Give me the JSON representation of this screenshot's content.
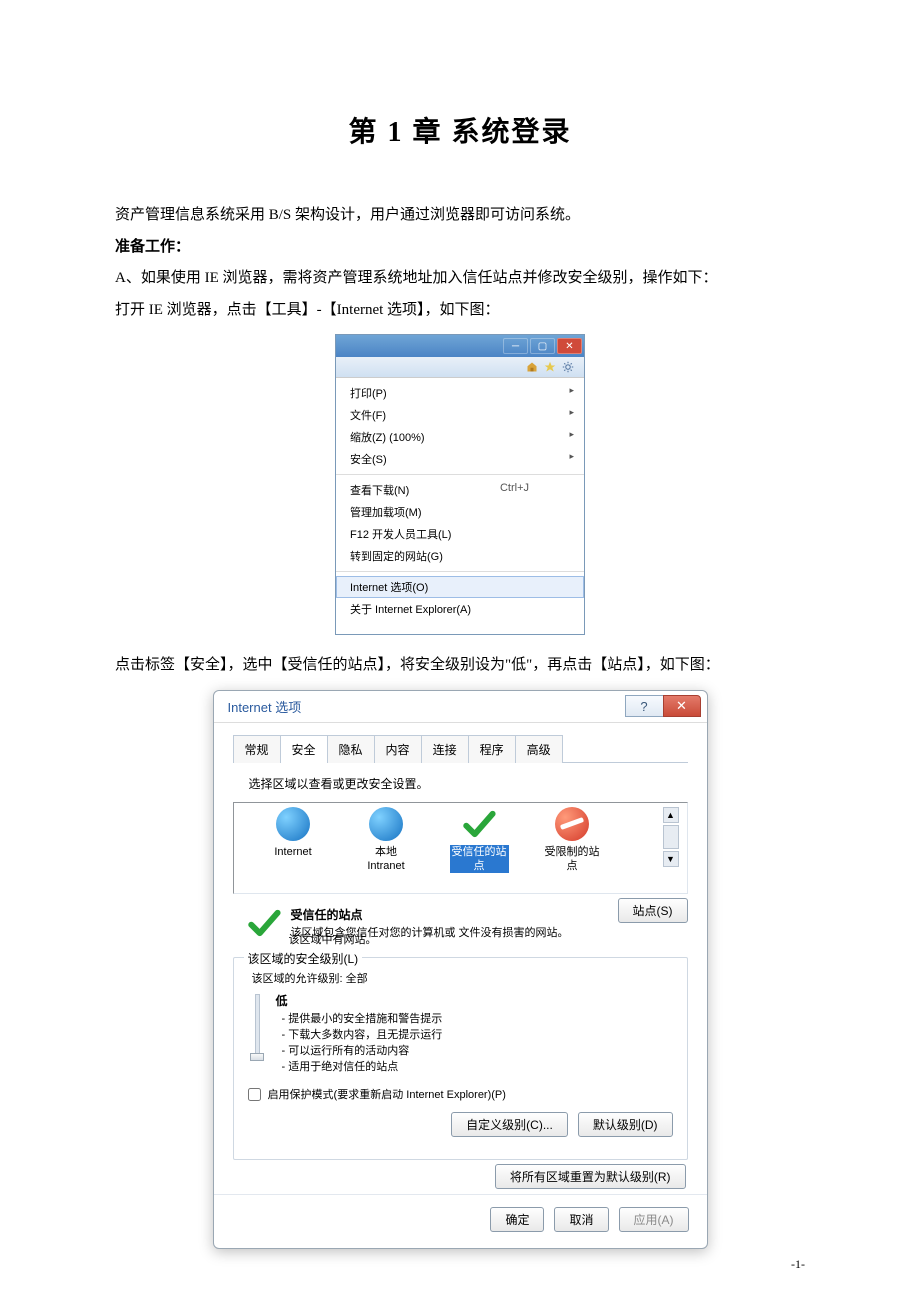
{
  "title": "第 1 章 系统登录",
  "para1": "资产管理信息系统采用 B/S 架构设计，用户通过浏览器即可访问系统。",
  "prep_label": "准备工作：",
  "para2": "A、如果使用 IE 浏览器，需将资产管理系统地址加入信任站点并修改安全级别，操作如下：",
  "para3": "打开 IE 浏览器，点击【工具】-【Internet 选项】，如下图：",
  "ie_menu": {
    "items1": [
      {
        "label": "打印(P)",
        "arrow": true
      },
      {
        "label": "文件(F)",
        "arrow": true
      },
      {
        "label": "缩放(Z) (100%)",
        "arrow": true
      },
      {
        "label": "安全(S)",
        "arrow": true
      }
    ],
    "items2": [
      {
        "label": "查看下载(N)",
        "shortcut": "Ctrl+J"
      },
      {
        "label": "管理加载项(M)"
      },
      {
        "label": "F12 开发人员工具(L)"
      },
      {
        "label": "转到固定的网站(G)"
      }
    ],
    "items3": [
      {
        "label": "Internet 选项(O)",
        "highlight": true
      },
      {
        "label": "关于 Internet Explorer(A)"
      }
    ]
  },
  "para4": "点击标签【安全】，选中【受信任的站点】，将安全级别设为\"低\"，再点击【站点】，如下图：",
  "dialog": {
    "title": "Internet 选项",
    "tabs": [
      "常规",
      "安全",
      "隐私",
      "内容",
      "连接",
      "程序",
      "高级"
    ],
    "active_tab": 1,
    "zone_instr": "选择区域以查看或更改安全设置。",
    "zones": [
      {
        "name": "Internet",
        "type": "internet"
      },
      {
        "name": "本地\nIntranet",
        "type": "intranet"
      },
      {
        "name": "受信任的站\n点",
        "type": "trusted",
        "selected": true
      },
      {
        "name": "受限制的站\n点",
        "type": "restricted"
      }
    ],
    "zone_title": "受信任的站点",
    "zone_desc": "该区域包含您信任对您的计算机或\n文件没有损害的网站。",
    "sites_btn": "站点(S)",
    "zone_has_sites": "该区域中有网站。",
    "sec_legend": "该区域的安全级别(L)",
    "allow_line": "该区域的允许级别:  全部",
    "level_name": "低",
    "bullets": [
      "提供最小的安全措施和警告提示",
      "下载大多数内容，且无提示运行",
      "可以运行所有的活动内容",
      "适用于绝对信任的站点"
    ],
    "protect_label": "启用保护模式(要求重新启动 Internet Explorer)(P)",
    "custom_btn": "自定义级别(C)...",
    "default_btn": "默认级别(D)",
    "reset_btn": "将所有区域重置为默认级别(R)",
    "ok": "确定",
    "cancel": "取消",
    "apply": "应用(A)"
  },
  "page_num": "-1-"
}
